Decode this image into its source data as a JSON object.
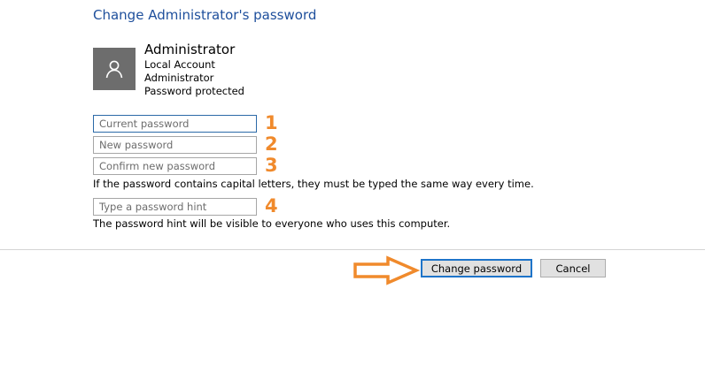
{
  "page": {
    "title": "Change Administrator's password"
  },
  "account": {
    "name": "Administrator",
    "lines": [
      "Local Account",
      "Administrator",
      "Password protected"
    ],
    "avatar_icon": "user-icon"
  },
  "form": {
    "current_password_placeholder": "Current password",
    "new_password_placeholder": "New password",
    "confirm_password_placeholder": "Confirm new password",
    "capital_letters_note": "If the password contains capital letters, they must be typed the same way every time.",
    "hint_placeholder": "Type a password hint",
    "hint_note": "The password hint will be visible to everyone who uses this computer."
  },
  "annotations": {
    "numbers": [
      "1",
      "2",
      "3",
      "4"
    ],
    "color": "#f08a2c",
    "arrow_icon": "right-arrow-icon"
  },
  "buttons": {
    "change_password_label": "Change password",
    "cancel_label": "Cancel"
  },
  "colors": {
    "title": "#1e4f9c",
    "avatar_bg": "#6d6d6d",
    "focus_border": "#2b6aa8",
    "primary_button_border": "#1e74c9"
  }
}
